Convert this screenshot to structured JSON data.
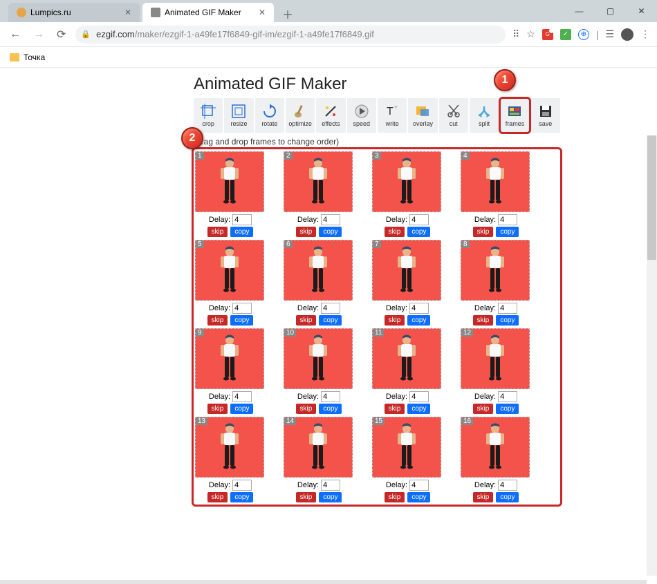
{
  "window": {
    "tabs": [
      {
        "title": "Lumpics.ru",
        "active": false,
        "favicon": "orange"
      },
      {
        "title": "Animated GIF Maker",
        "active": true,
        "favicon": "gray"
      }
    ],
    "controls": {
      "min": "—",
      "max": "▢",
      "close": "✕"
    }
  },
  "address": {
    "url_domain": "ezgif.com",
    "url_path": "/maker/ezgif-1-a49fe17f6849-gif-im/ezgif-1-a49fe17f6849.gif"
  },
  "bookmarks": {
    "item0": "Точка"
  },
  "page": {
    "title": "Animated GIF Maker",
    "instruction": "(drag and drop frames to change order)"
  },
  "toolbar": {
    "crop": "crop",
    "resize": "resize",
    "rotate": "rotate",
    "optimize": "optimize",
    "effects": "effects",
    "speed": "speed",
    "write": "write",
    "overlay": "overlay",
    "cut": "cut",
    "split": "split",
    "frames": "frames",
    "save": "save"
  },
  "frames": {
    "delay_label": "Delay:",
    "skip_label": "skip",
    "copy_label": "copy",
    "items": [
      {
        "n": "1",
        "delay": "4"
      },
      {
        "n": "2",
        "delay": "4"
      },
      {
        "n": "3",
        "delay": "4"
      },
      {
        "n": "4",
        "delay": "4"
      },
      {
        "n": "5",
        "delay": "4"
      },
      {
        "n": "6",
        "delay": "4"
      },
      {
        "n": "7",
        "delay": "4"
      },
      {
        "n": "8",
        "delay": "4"
      },
      {
        "n": "9",
        "delay": "4"
      },
      {
        "n": "10",
        "delay": "4"
      },
      {
        "n": "11",
        "delay": "4"
      },
      {
        "n": "12",
        "delay": "4"
      },
      {
        "n": "13",
        "delay": "4"
      },
      {
        "n": "14",
        "delay": "4"
      },
      {
        "n": "15",
        "delay": "4"
      },
      {
        "n": "16",
        "delay": "4"
      }
    ]
  },
  "callouts": {
    "c1": "1",
    "c2": "2"
  }
}
